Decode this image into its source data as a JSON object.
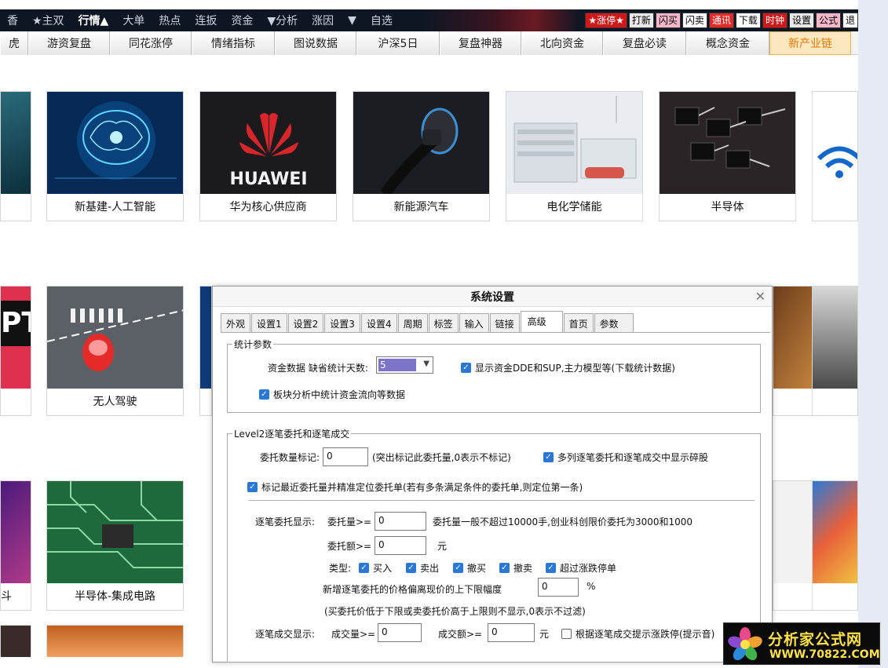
{
  "menubar": {
    "items": [
      "香",
      "★主双",
      "行情▲",
      "大单",
      "热点",
      "连扳",
      "资金",
      "▼分析",
      "涨因",
      "▼",
      "自选"
    ],
    "active_index": 2,
    "buttons": [
      {
        "label": "★涨停★",
        "bg": "#d01818",
        "fg": "#ffffff"
      },
      {
        "label": "打新",
        "bg": "#e8e8e8",
        "fg": "#000000"
      },
      {
        "label": "闪买",
        "bg": "#f8b8c8",
        "fg": "#000000"
      },
      {
        "label": "闪卖",
        "bg": "#ffffff",
        "fg": "#000000"
      },
      {
        "label": "通讯",
        "bg": "#e52a2a",
        "fg": "#ffffff"
      },
      {
        "label": "下载",
        "bg": "#ffffff",
        "fg": "#000000"
      },
      {
        "label": "时钟",
        "bg": "#d01818",
        "fg": "#ffffff"
      },
      {
        "label": "设置",
        "bg": "#e8e8e8",
        "fg": "#000000"
      },
      {
        "label": "公式",
        "bg": "#f8b8c8",
        "fg": "#000000"
      },
      {
        "label": "退",
        "bg": "#ffffff",
        "fg": "#000000"
      }
    ]
  },
  "tabs": [
    "虎",
    "游资复盘",
    "同花涨停",
    "情绪指标",
    "图说数据",
    "沪深5日",
    "复盘神器",
    "北向资金",
    "复盘必读",
    "概念资金",
    "新产业链"
  ],
  "tabs_highlight_index": 10,
  "cards_row1": [
    "新基建-人工智能",
    "华为核心供应商",
    "新能源汽车",
    "电化学储能",
    "半导体"
  ],
  "card_row2": "无人驾驶",
  "card_row3": "半导体-集成电路",
  "huawei_logo_text": "HUAWEI",
  "pt_text": "PT",
  "left_partial": "斗",
  "dialog": {
    "title": "系统设置",
    "tabs": [
      "外观",
      "设置1",
      "设置2",
      "设置3",
      "设置4",
      "周期",
      "标签",
      "输入",
      "链接",
      "高级",
      "首页",
      "参数"
    ],
    "selected_tab": "高级",
    "group1": {
      "legend": "统计参数",
      "days_label": "资金数据 缺省统计天数:",
      "days_value": "5",
      "chk_dde": "显示资金DDE和SUP,主力模型等(下载统计数据)",
      "chk_block": "板块分析中统计资金流向等数据"
    },
    "group2": {
      "legend": "Level2逐笔委托和逐笔成交",
      "mark_label": "委托数量标记:",
      "mark_value": "0",
      "mark_hint": "(突出标记此委托量,0表示不标记)",
      "chk_multi": "多列逐笔委托和逐笔成交中显示碎股",
      "chk_recent": "标记最近委托量并精准定位委托单(若有多条满足条件的委托单,则定位第一条)",
      "show_label": "逐笔委托显示:",
      "qty_label": "委托量>=",
      "qty_value": "0",
      "qty_hint": "委托量一般不超过10000手,创业科创限价委托为3000和1000",
      "amt_label": "委托额>=",
      "amt_value": "0",
      "amt_unit": "元",
      "type_label": "类型:",
      "types": [
        "买入",
        "卖出",
        "撤买",
        "撤卖",
        "超过涨跌停单"
      ],
      "range_label": "新增逐笔委托的价格偏离现价的上下限幅度",
      "range_value": "0",
      "range_unit": "%",
      "range_hint": "(买委托价低于下限或卖委托价高于上限则不显示,0表示不过滤)",
      "deal_label": "逐笔成交显示:",
      "deal_qty_label": "成交量>=",
      "deal_qty_value": "0",
      "deal_amt_label": "成交额>=",
      "deal_amt_value": "0",
      "deal_amt_unit": "元",
      "chk_sound": "根据逐笔成交提示涨跌停(提示音)"
    }
  },
  "watermark": {
    "line1": "分析家公式网",
    "line2": "WWW.70822.COM"
  }
}
